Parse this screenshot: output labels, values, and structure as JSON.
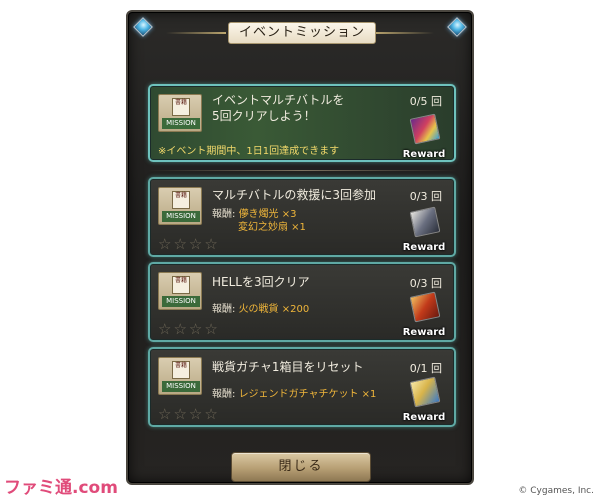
{
  "dialog": {
    "title": "イベントミッション",
    "close_label": "閉じる"
  },
  "missions": [
    {
      "title_line1": "イベントマルチバトルを",
      "title_line2": "5回クリアしよう！",
      "count": "0/5 回",
      "note": "※イベント期間中、1日1回達成できます",
      "reward_label": "Reward",
      "icon_text": "MISSION",
      "icon_scroll": "書籍"
    },
    {
      "title": "マルチバトルの救援に3回参加",
      "count": "0/3 回",
      "reward_prefix": "報酬:",
      "reward_item1": "儚き燭光 ×3",
      "reward_item2": "変幻之妙扇 ×1",
      "reward_label": "Reward",
      "icon_text": "MISSION",
      "icon_scroll": "書籍",
      "stars": "☆☆☆☆"
    },
    {
      "title": "HELLを3回クリア",
      "count": "0/3 回",
      "reward_prefix": "報酬:",
      "reward_item1": "火の戦貨 ×200",
      "reward_label": "Reward",
      "icon_text": "MISSION",
      "icon_scroll": "書籍",
      "stars": "☆☆☆☆"
    },
    {
      "title": "戦貨ガチャ1箱目をリセット",
      "count": "0/1 回",
      "reward_prefix": "報酬:",
      "reward_item1": "レジェンドガチャチケット ×1",
      "reward_label": "Reward",
      "icon_text": "MISSION",
      "icon_scroll": "書籍",
      "stars": "☆☆☆☆"
    }
  ],
  "watermark": {
    "logo": "ファミ通.com",
    "copyright": "© Cygames, Inc."
  },
  "colors": {
    "accent_border": "#5fa9a4",
    "reward_item": "#f0b63a",
    "note": "#f2d96b",
    "highlight_bg": "#3a5a36"
  },
  "icons": [
    "corner-gem-icon",
    "mission-scroll-icon",
    "reward-card-icon",
    "star-icon"
  ]
}
